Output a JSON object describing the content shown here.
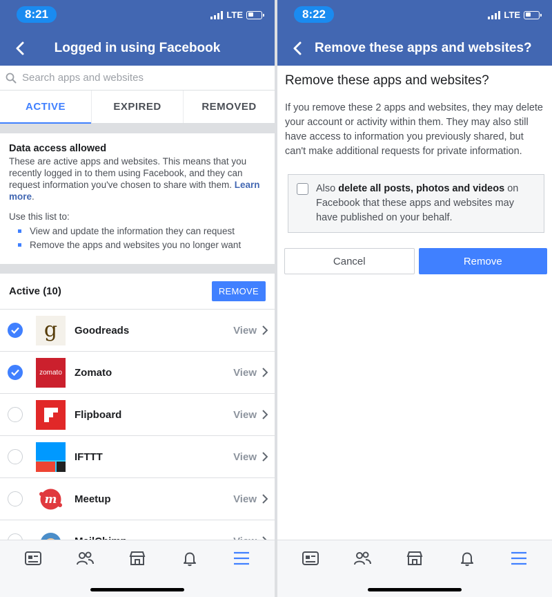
{
  "left": {
    "status": {
      "time": "8:21",
      "network": "LTE"
    },
    "nav_title": "Logged in using Facebook",
    "search_placeholder": "Search apps and websites",
    "tabs": [
      "ACTIVE",
      "EXPIRED",
      "REMOVED"
    ],
    "info": {
      "heading": "Data access allowed",
      "text": "These are active apps and websites. This means that you recently logged in to them using Facebook, and they can request information you've chosen to share with them.",
      "learn_more": "Learn more",
      "use_intro": "Use this list to:",
      "bullets": [
        "View and update the information they can request",
        "Remove the apps and websites you no longer want"
      ]
    },
    "active_title": "Active (10)",
    "remove_label": "REMOVE",
    "view_label": "View",
    "apps": [
      {
        "name": "Goodreads",
        "checked": true
      },
      {
        "name": "Zomato",
        "checked": true,
        "icon_text": "zomato"
      },
      {
        "name": "Flipboard",
        "checked": false
      },
      {
        "name": "IFTTT",
        "checked": false
      },
      {
        "name": "Meetup",
        "checked": false
      },
      {
        "name": "MailChimp",
        "checked": false
      }
    ]
  },
  "right": {
    "status": {
      "time": "8:22",
      "network": "LTE"
    },
    "nav_title": "Remove these apps and websites?",
    "heading": "Remove these apps and websites?",
    "body": "If you remove these 2 apps and websites, they may delete your account or activity within them. They may also still have access to information you previously shared, but can't make additional requests for private information.",
    "option_prefix": "Also ",
    "option_bold": "delete all posts, photos and videos",
    "option_suffix": " on Facebook that these apps and websites may have published on your behalf.",
    "cancel_label": "Cancel",
    "remove_label": "Remove"
  },
  "colors": {
    "brand": "#4267b2",
    "accent": "#4080ff"
  }
}
